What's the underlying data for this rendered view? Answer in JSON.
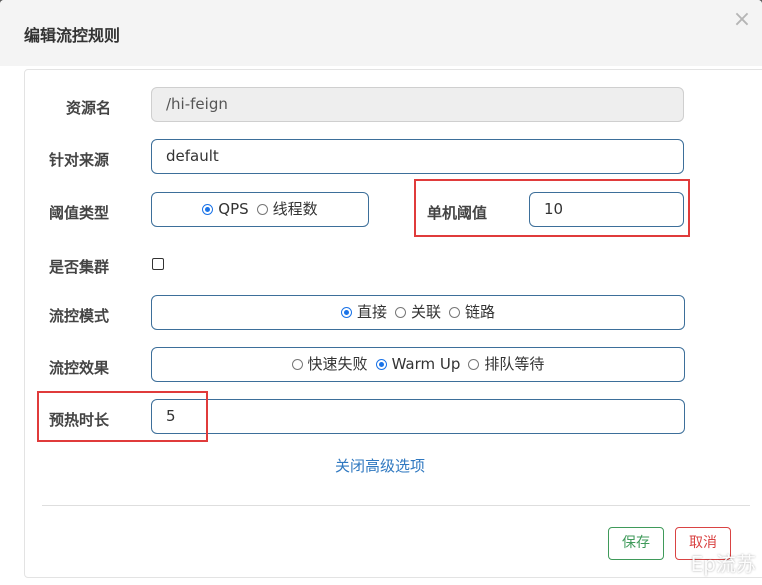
{
  "dialog": {
    "title": "编辑流控规则",
    "close_glyph": "×"
  },
  "form": {
    "resource": {
      "label": "资源名",
      "value": "/hi-feign"
    },
    "source": {
      "label": "针对来源",
      "value": "default"
    },
    "threshold_type": {
      "label": "阈值类型",
      "options": [
        "QPS",
        "线程数"
      ],
      "selected": "QPS"
    },
    "single_threshold": {
      "label": "单机阈值",
      "value": "10"
    },
    "cluster": {
      "label": "是否集群",
      "checked": false
    },
    "flow_mode": {
      "label": "流控模式",
      "options": [
        "直接",
        "关联",
        "链路"
      ],
      "selected": "直接"
    },
    "flow_effect": {
      "label": "流控效果",
      "options": [
        "快速失败",
        "Warm Up",
        "排队等待"
      ],
      "selected": "Warm Up"
    },
    "warmup_duration": {
      "label": "预热时长",
      "value": "5"
    },
    "advanced_toggle": "关闭高级选项"
  },
  "footer": {
    "save_label": "保存",
    "cancel_label": "取消"
  },
  "watermark": "Ep流苏",
  "colors": {
    "accent": "#1a73e8",
    "save": "#3f9a5a",
    "cancel": "#d94343",
    "highlight": "#e03b3b",
    "link": "#2f78c0"
  }
}
